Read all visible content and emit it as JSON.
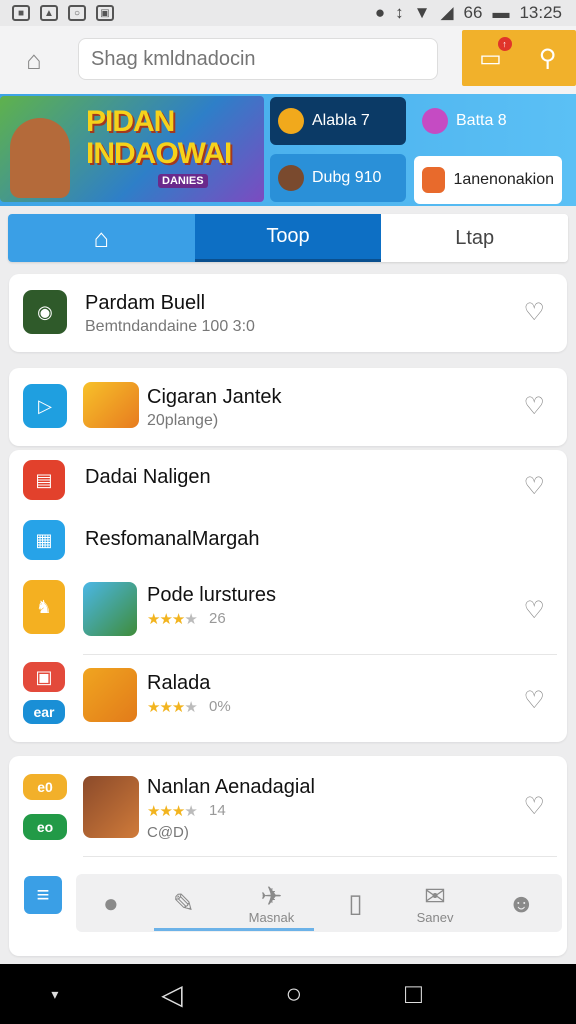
{
  "status": {
    "time": "13:25",
    "battery": "66"
  },
  "search": {
    "placeholder": "Shag kmldnadocin"
  },
  "banner": {
    "hero_title_1": "PIDAN",
    "hero_title_2": "INDAOWAI",
    "hero_sub": "DANIES",
    "chips": [
      {
        "label": "Alabla 7"
      },
      {
        "label": "Batta 8"
      },
      {
        "label": "Dubg 910"
      },
      {
        "label": "1anenonakion"
      }
    ]
  },
  "tabs": {
    "top": "Toop",
    "list": "Ltap"
  },
  "items": [
    {
      "title": "Pardam Buell",
      "sub": "Bemtndandaine 100 3:0"
    },
    {
      "title": "Cigaran Jantek",
      "sub": "20plange)"
    },
    {
      "title": "Dadai Naligen"
    },
    {
      "title": "ResfomanalMargah"
    },
    {
      "title": "Pode lurstures",
      "rating": "26",
      "stars_value": 3
    },
    {
      "title": "Ralada",
      "rating": "0%",
      "stars_value": 3
    },
    {
      "title": "Nanlan Aenadagial",
      "rating": "14",
      "sub": "C@D)",
      "stars_value": 3
    },
    {
      "badge_a": "e0",
      "badge_b": "eo"
    }
  ],
  "icons_text": {
    "a": "e0",
    "b": "eo",
    "c": "ear"
  },
  "bottom_nav": {
    "maps": "Masnak",
    "save": "Sanev"
  },
  "colors": {
    "accent": "#3a9fe6",
    "tab_active": "#0d6fc4",
    "top_actions": "#f1b12b",
    "star": "#f2b41f"
  }
}
